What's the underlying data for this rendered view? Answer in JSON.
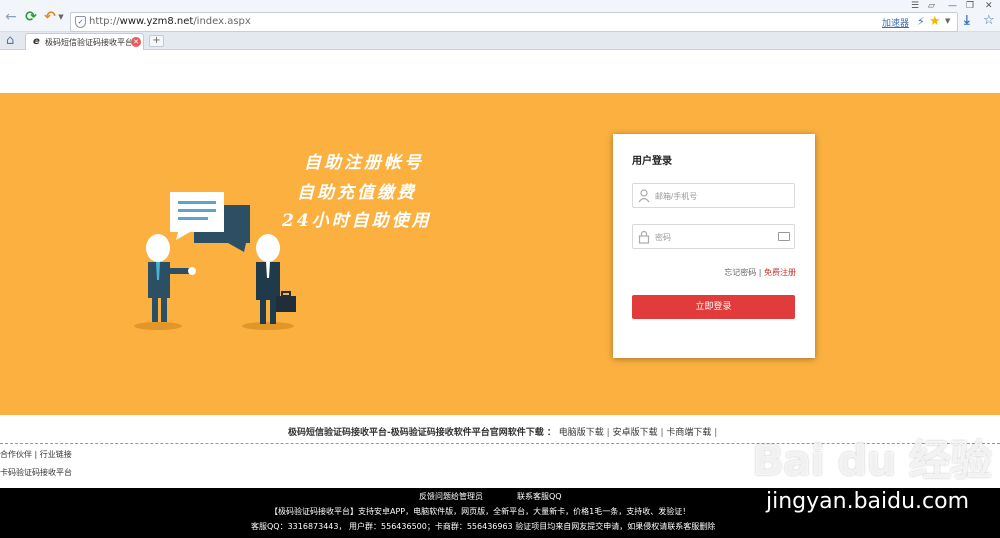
{
  "browser": {
    "url_prefix": "http://",
    "url_domain": "www.yzm8.net",
    "url_path": "/index.aspx",
    "accelerator_label": "加速器",
    "tab_title": "极码短信验证码接收平台-",
    "new_tab_symbol": "+",
    "colors": {
      "tab_close": "#e45c5c",
      "link": "#3e6eb4"
    }
  },
  "banner": {
    "background": "#fbb040",
    "slogans": [
      "自助注册帐号",
      "自助充值缴费",
      "24小时自助使用"
    ]
  },
  "login": {
    "title": "用户登录",
    "username_placeholder": "邮箱/手机号",
    "password_placeholder": "密码",
    "forgot_label": "忘记密码",
    "separator": "|",
    "register_label": "免费注册",
    "submit_label": "立即登录",
    "button_color": "#e23b3b"
  },
  "downloads": {
    "site_name": "极码短信验证码接收平台-极码验证码接收软件平台官网",
    "label": "软件下载 ：",
    "items": [
      "电脑版下载",
      "安卓版下载",
      "卡商端下载"
    ],
    "separator": "|"
  },
  "partners": {
    "label": "合作伙伴",
    "separator": "|",
    "industry_label": "行业链接",
    "link_text": "卡码验证码接收平台"
  },
  "footer": {
    "feedback_label": "反馈问题给管理员",
    "contact_label": "联系客服QQ",
    "line2": "【极码验证码接收平台】支持安卓APP，电脑软件版，网页版，全新平台，大量新卡，价格1毛一条，支持收、发验证！",
    "line3": "客服QQ：3316873443， 用户群：556436500；卡商群：556436963 验证项目均来自网友提交申请，如果侵权请联系客服删除"
  },
  "watermark": {
    "logo_text": "Bai du 经验",
    "url_text": "jingyan.baidu.com"
  }
}
